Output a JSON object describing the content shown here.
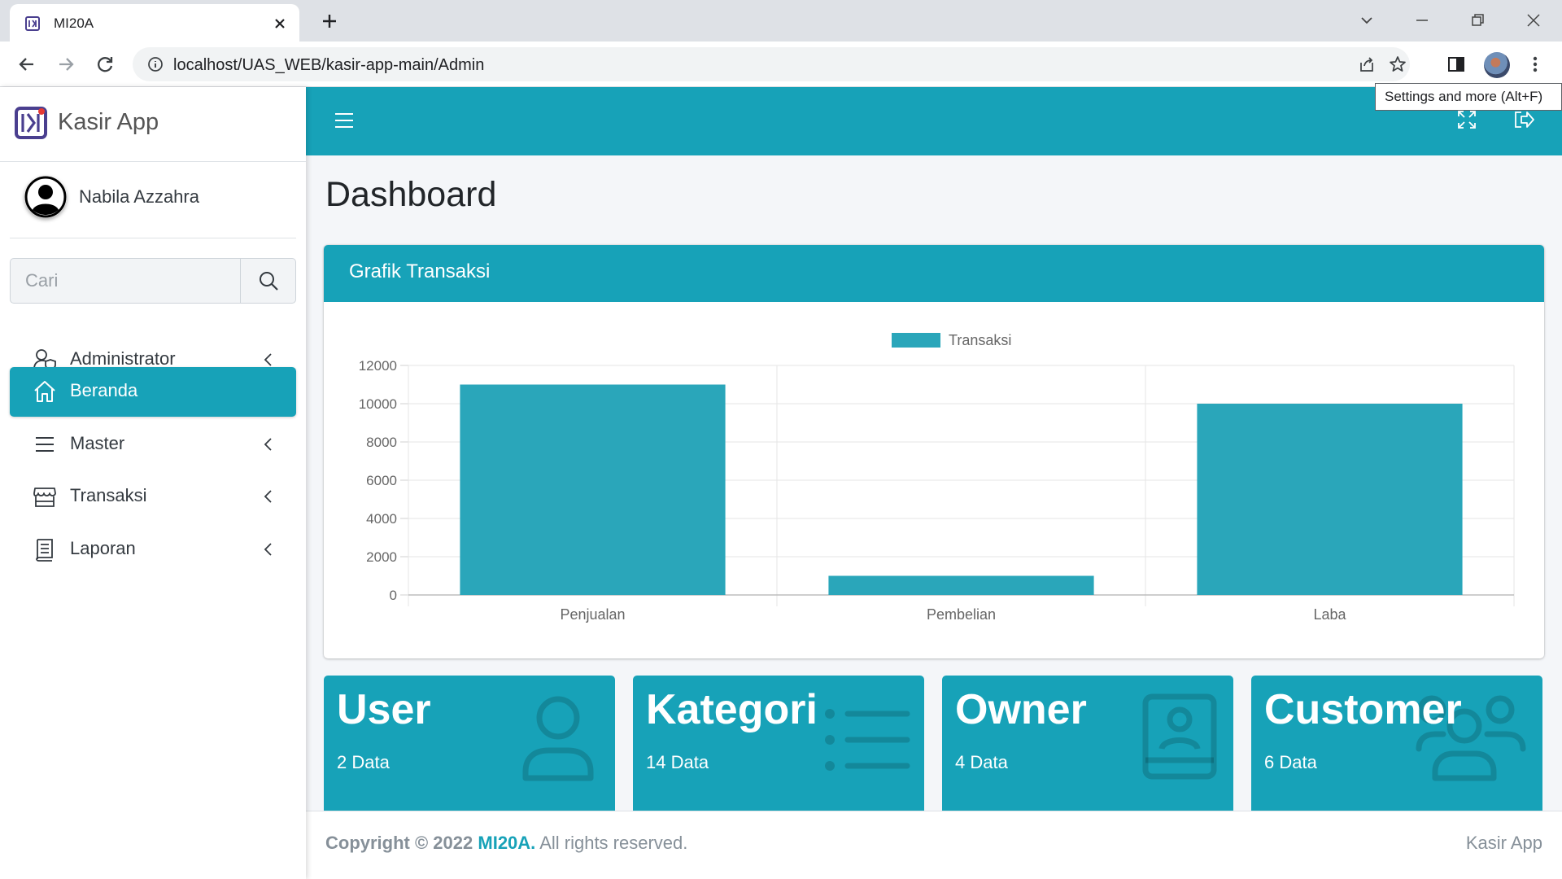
{
  "browser": {
    "tab_title": "MI20A",
    "url": "localhost/UAS_WEB/kasir-app-main/Admin",
    "tooltip": "Settings and more (Alt+F)"
  },
  "sidebar": {
    "brand": "Kasir App",
    "user_name": "Nabila Azzahra",
    "search_placeholder": "Cari",
    "items": [
      {
        "label": "Administrator",
        "icon": "user-shield-icon",
        "active": false,
        "has_submenu": true
      },
      {
        "label": "Beranda",
        "icon": "home-icon",
        "active": true,
        "has_submenu": false
      },
      {
        "label": "Master",
        "icon": "list-icon",
        "active": false,
        "has_submenu": true
      },
      {
        "label": "Transaksi",
        "icon": "store-icon",
        "active": false,
        "has_submenu": true
      },
      {
        "label": "Laporan",
        "icon": "report-icon",
        "active": false,
        "has_submenu": true
      }
    ]
  },
  "main": {
    "page_title": "Dashboard",
    "card_title": "Grafik Transaksi"
  },
  "chart_data": {
    "type": "bar",
    "categories": [
      "Penjualan",
      "Pembelian",
      "Laba"
    ],
    "series": [
      {
        "name": "Transaksi",
        "values": [
          11000,
          1000,
          10000
        ]
      }
    ],
    "ylim": [
      0,
      12000
    ],
    "yticks": [
      "0",
      "2000",
      "4000",
      "6000",
      "8000",
      "10000",
      "12000"
    ],
    "legend_position": "top",
    "grid": true,
    "color": "#2aa6ba"
  },
  "stat_boxes": [
    {
      "title": "User",
      "subtitle": "2 Data",
      "icon": "user-icon"
    },
    {
      "title": "Kategori",
      "subtitle": "14 Data",
      "icon": "list-icon"
    },
    {
      "title": "Owner",
      "subtitle": "4 Data",
      "icon": "contact-book-icon"
    },
    {
      "title": "Customer",
      "subtitle": "6 Data",
      "icon": "users-icon"
    }
  ],
  "footer": {
    "copyright_prefix": "Copyright © 2022 ",
    "brand": "MI20A.",
    "rights": " All rights reserved.",
    "app": "Kasir App"
  },
  "colors": {
    "accent": "#17a2b8",
    "bar": "#2aa6ba",
    "content_bg": "#f4f6f9"
  }
}
